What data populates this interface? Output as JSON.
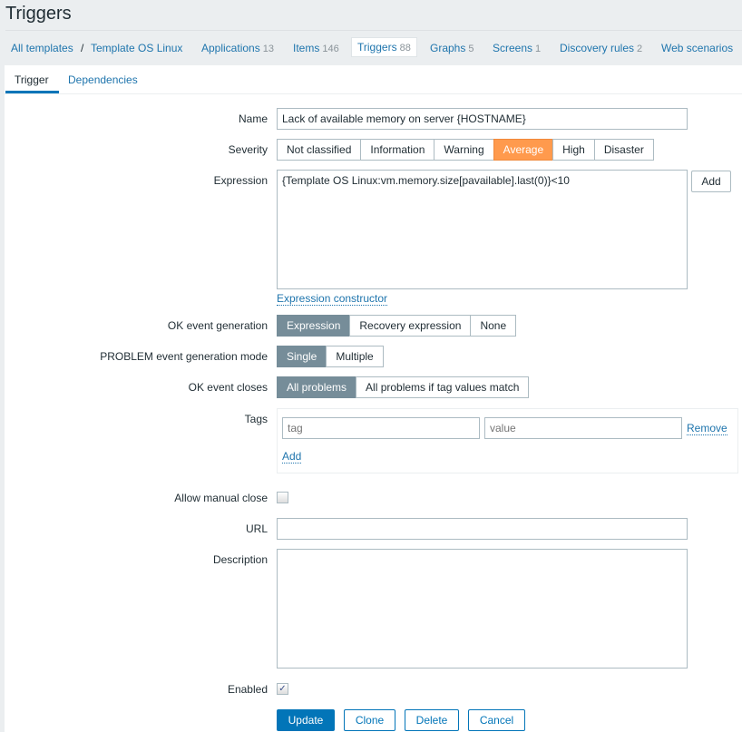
{
  "page_title": "Triggers",
  "nav": {
    "breadcrumb": [
      "All templates",
      "Template OS Linux"
    ],
    "sep": "/",
    "items": [
      {
        "label": "Applications",
        "count": "13"
      },
      {
        "label": "Items",
        "count": "146"
      },
      {
        "label": "Triggers",
        "count": "88"
      },
      {
        "label": "Graphs",
        "count": "5"
      },
      {
        "label": "Screens",
        "count": "1"
      },
      {
        "label": "Discovery rules",
        "count": "2"
      },
      {
        "label": "Web scenarios",
        "count": ""
      }
    ]
  },
  "tabs": [
    "Trigger",
    "Dependencies"
  ],
  "form": {
    "name_label": "Name",
    "name_value": "Lack of available memory on server {HOSTNAME}",
    "severity_label": "Severity",
    "severity_options": [
      "Not classified",
      "Information",
      "Warning",
      "Average",
      "High",
      "Disaster"
    ],
    "severity_selected": "Average",
    "expression_label": "Expression",
    "expression_value": "{Template OS Linux:vm.memory.size[pavailable].last(0)}<10",
    "add_label": "Add",
    "constructor_link": "Expression constructor",
    "ok_gen_label": "OK event generation",
    "ok_gen_options": [
      "Expression",
      "Recovery expression",
      "None"
    ],
    "ok_gen_selected": "Expression",
    "problem_mode_label": "PROBLEM event generation mode",
    "problem_mode_options": [
      "Single",
      "Multiple"
    ],
    "problem_mode_selected": "Single",
    "ok_closes_label": "OK event closes",
    "ok_closes_options": [
      "All problems",
      "All problems if tag values match"
    ],
    "ok_closes_selected": "All problems",
    "tags_label": "Tags",
    "tag_placeholder": "tag",
    "value_placeholder": "value",
    "remove_label": "Remove",
    "tag_add_label": "Add",
    "manual_close_label": "Allow manual close",
    "manual_close_checked": false,
    "url_label": "URL",
    "url_value": "",
    "description_label": "Description",
    "description_value": "",
    "enabled_label": "Enabled",
    "enabled_checked": true
  },
  "buttons": {
    "update": "Update",
    "clone": "Clone",
    "delete": "Delete",
    "cancel": "Cancel"
  },
  "colors": {
    "accent": "#0275b8",
    "severity_average": "#ff9a4d",
    "selected_segment": "#768d99"
  }
}
